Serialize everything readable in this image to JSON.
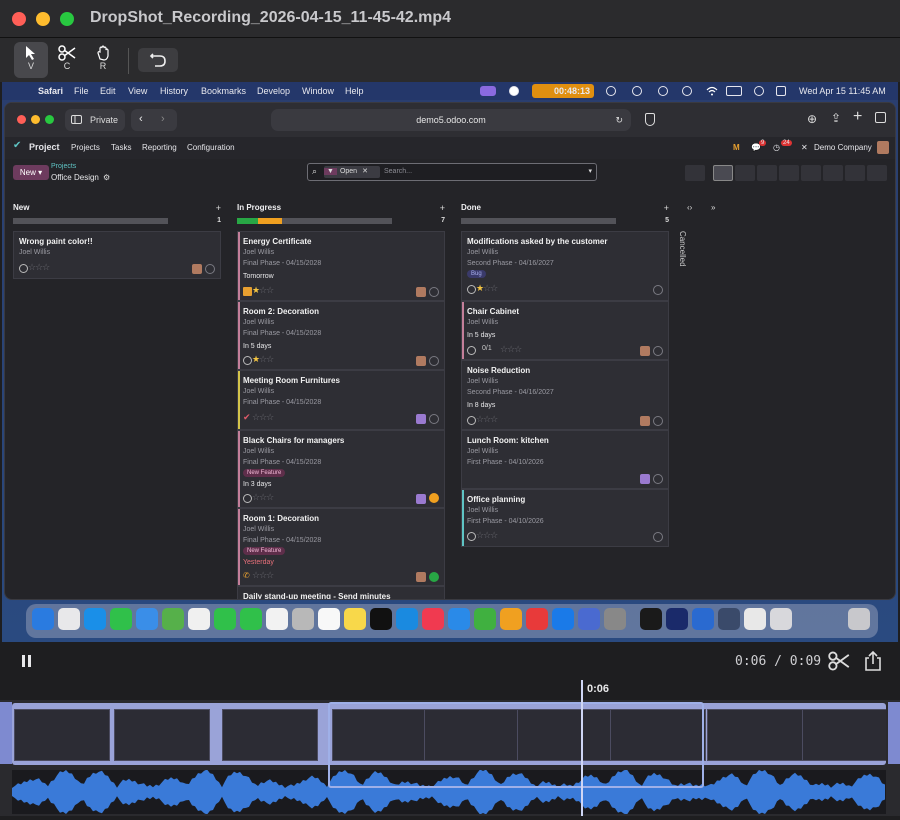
{
  "window": {
    "title": "DropShot_Recording_2026-04-15_11-45-42.mp4"
  },
  "tools": [
    {
      "key": "V",
      "name": "select"
    },
    {
      "key": "C",
      "name": "cut"
    },
    {
      "key": "R",
      "name": "hand"
    }
  ],
  "macos": {
    "apple": "",
    "app": "Safari",
    "menus": [
      "File",
      "Edit",
      "View",
      "History",
      "Bookmarks",
      "Develop",
      "Window",
      "Help"
    ],
    "rec_time": "00:48:13",
    "clock": "Wed Apr 15  11:45 AM"
  },
  "safari": {
    "private_label": "Private",
    "url": "demo5.odoo.com"
  },
  "odoo": {
    "app": "Project",
    "menu": [
      "Projects",
      "Tasks",
      "Reporting",
      "Configuration"
    ],
    "badges": {
      "chat": "9",
      "activity": "24"
    },
    "company": "Demo Company",
    "new_label": "New",
    "breadcrumb_parent": "Projects",
    "breadcrumb_current": "Office Design",
    "search_facet": "Open",
    "search_placeholder": "Search..."
  },
  "columns": [
    {
      "name": "New",
      "count": "1",
      "cards": [
        {
          "title": "Wrong paint color!!",
          "assignee": "Joel Willis",
          "stars": 0
        }
      ]
    },
    {
      "name": "In Progress",
      "count": "7",
      "cards": [
        {
          "title": "Energy Certificate",
          "assignee": "Joel Willis",
          "phase": "Final Phase - 04/15/2028",
          "due": "Tomorrow",
          "stars": 1
        },
        {
          "title": "Room 2: Decoration",
          "assignee": "Joel Willis",
          "phase": "Final Phase - 04/15/2028",
          "due": "In 5 days",
          "stars": 1
        },
        {
          "title": "Meeting Room Furnitures",
          "assignee": "Joel Willis",
          "phase": "Final Phase - 04/15/2028",
          "stars": 0
        },
        {
          "title": "Black Chairs for managers",
          "assignee": "Joel Willis",
          "phase": "Final Phase - 04/15/2028",
          "tag": "New Feature",
          "due": "In 3 days",
          "stars": 0
        },
        {
          "title": "Room 1: Decoration",
          "assignee": "Joel Willis",
          "phase": "Final Phase - 04/15/2028",
          "tag": "New Feature",
          "due": "Yesterday",
          "stars": 0
        },
        {
          "title": "Daily stand-up meeting - Send minutes"
        }
      ]
    },
    {
      "name": "Done",
      "count": "5",
      "cards": [
        {
          "title": "Modifications asked by the customer",
          "assignee": "Joel Willis",
          "phase": "Second Phase - 04/16/2027",
          "tag": "Bug",
          "stars": 1
        },
        {
          "title": "Chair Cabinet",
          "assignee": "Joel Willis",
          "due": "In 5 days",
          "subtasks": "0/1",
          "stars": 0
        },
        {
          "title": "Noise Reduction",
          "assignee": "Joel Willis",
          "phase": "Second Phase - 04/16/2027",
          "due": "In 8 days",
          "stars": 0
        },
        {
          "title": "Lunch Room: kitchen",
          "assignee": "Joel Willis",
          "phase": "First Phase - 04/10/2026",
          "stars": 0
        },
        {
          "title": "Office planning",
          "assignee": "Joel Willis",
          "phase": "First Phase - 04/10/2026",
          "stars": 0
        }
      ]
    }
  ],
  "folded_column": "Cancelled",
  "player": {
    "current": "0:06",
    "duration": "0:09",
    "separator": "/",
    "playhead_label": "0:06",
    "position": 0.667
  }
}
